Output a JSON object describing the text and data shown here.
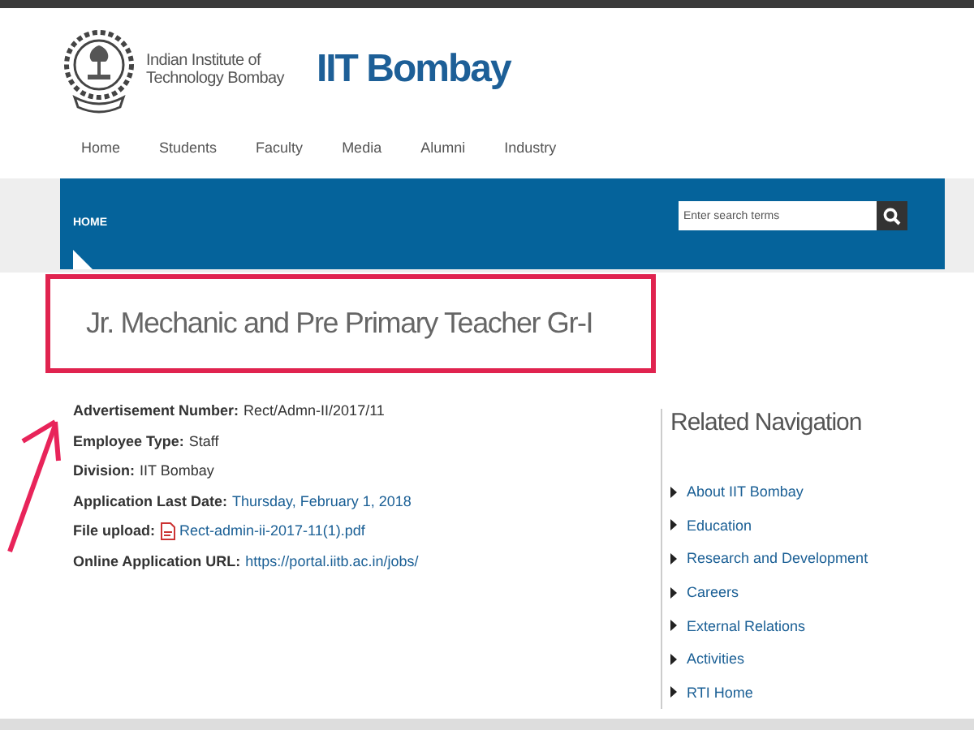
{
  "header": {
    "logo_text": [
      "Indian Institute of",
      "Technology Bombay"
    ],
    "site_title": "IIT Bombay"
  },
  "nav": [
    "Home",
    "Students",
    "Faculty",
    "Media",
    "Alumni",
    "Industry"
  ],
  "banner": {
    "breadcrumb": "HOME",
    "search": {
      "placeholder": "Enter search terms"
    }
  },
  "page_title": "Jr. Mechanic and Pre Primary Teacher Gr-I",
  "details": [
    {
      "label": "Advertisement Number:",
      "value": "Rect/Admn-II/2017/11",
      "kind": "text"
    },
    {
      "label": "Employee Type:",
      "value": "Staff",
      "kind": "text"
    },
    {
      "label": "Division:",
      "value": "IIT Bombay",
      "kind": "text"
    },
    {
      "label": "Application Last Date:",
      "value": "Thursday, February 1, 2018",
      "kind": "date"
    },
    {
      "label": "File upload:",
      "value": "Rect-admin-ii-2017-11(1).pdf",
      "kind": "file"
    },
    {
      "label": "Online Application URL:",
      "value": "https://portal.iitb.ac.in/jobs/",
      "kind": "link"
    }
  ],
  "related": {
    "title": "Related Navigation",
    "items": [
      "About IIT Bombay",
      "Education",
      "Research and Development",
      "Careers",
      "External Relations",
      "Activities",
      "RTI Home"
    ]
  }
}
